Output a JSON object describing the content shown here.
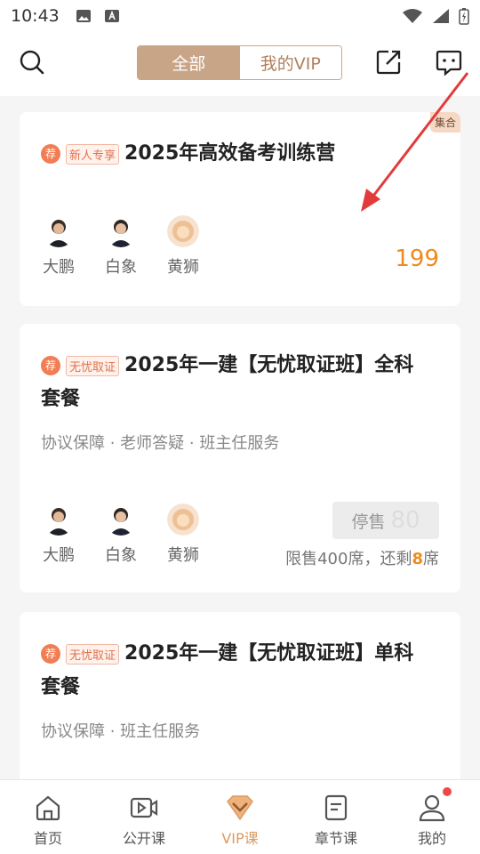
{
  "status_bar": {
    "time": "10:43"
  },
  "header": {
    "tabs": [
      "全部",
      "我的VIP"
    ]
  },
  "cards": [
    {
      "corner_tag": "集合",
      "badge": "荐",
      "tag": "新人专享",
      "title": "2025年高效备考训练营",
      "teachers": [
        "大鹏",
        "白象",
        "黄狮"
      ],
      "price": "199"
    },
    {
      "badge": "荐",
      "tag": "无忧取证",
      "title_line1": "2025年一建【无忧取证班】全科",
      "title_line2": "套餐",
      "subtitle": "协议保障 · 老师答疑 · 班主任服务",
      "teachers": [
        "大鹏",
        "白象",
        "黄狮"
      ],
      "button": "停售",
      "ghost_price": "80",
      "limit_prefix": "限售400席，还剩",
      "limit_count": "8",
      "limit_suffix": "席"
    },
    {
      "badge": "荐",
      "tag": "无忧取证",
      "title_line1": "2025年一建【无忧取证班】单科",
      "title_line2": "套餐",
      "subtitle": "协议保障 · 班主任服务"
    }
  ],
  "bottom_nav": [
    {
      "label": "首页",
      "icon": "home-icon"
    },
    {
      "label": "公开课",
      "icon": "video-icon"
    },
    {
      "label": "VIP课",
      "icon": "vip-icon",
      "active": true
    },
    {
      "label": "章节课",
      "icon": "document-icon"
    },
    {
      "label": "我的",
      "icon": "user-icon"
    }
  ],
  "colors": {
    "accent": "#c9a587",
    "price": "#ef8a1c",
    "tag_text": "#e1704c",
    "badge": "#f17d54",
    "notification": "#f04848"
  }
}
